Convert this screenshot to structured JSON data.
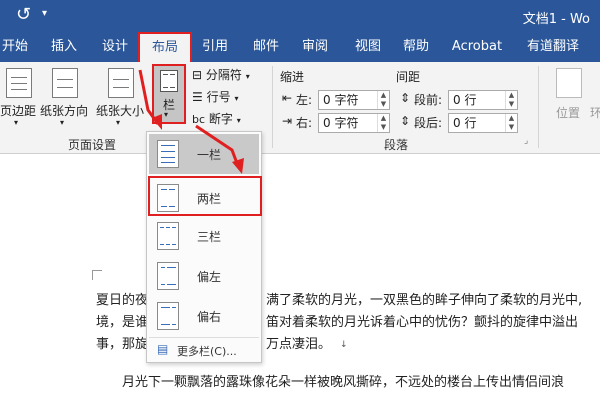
{
  "titlebar": {
    "doc_title": "文档1 - Wo"
  },
  "tabs": [
    {
      "label": "开始"
    },
    {
      "label": "插入"
    },
    {
      "label": "设计"
    },
    {
      "label": "布局"
    },
    {
      "label": "引用"
    },
    {
      "label": "邮件"
    },
    {
      "label": "审阅"
    },
    {
      "label": "视图"
    },
    {
      "label": "帮助"
    },
    {
      "label": "Acrobat"
    },
    {
      "label": "有道翻译"
    }
  ],
  "ribbon": {
    "margins": "页边距",
    "orientation": "纸张方向",
    "size": "纸张大小",
    "columns": "栏",
    "breaks": "分隔符",
    "line_numbers": "行号",
    "hyphenation": "断字",
    "page_setup_label": "页面设置",
    "indent_title": "缩进",
    "spacing_title": "间距",
    "indent_left_label": "左:",
    "indent_left_value": "0 字符",
    "indent_right_label": "右:",
    "indent_right_value": "0 字符",
    "spacing_before_label": "段前:",
    "spacing_before_value": "0 行",
    "spacing_after_label": "段后:",
    "spacing_after_value": "0 行",
    "paragraph_label": "段落",
    "position": "位置"
  },
  "columns_menu": {
    "items": [
      {
        "label": "一栏"
      },
      {
        "label": "两栏"
      },
      {
        "label": "三栏"
      },
      {
        "label": "偏左"
      },
      {
        "label": "偏右"
      }
    ],
    "more": "更多栏(C)..."
  },
  "document": {
    "line1a": "夏日的夜",
    "line1b": "满了柔软的月光，一双黑色的眸子伸向了柔软的月光中,",
    "line2a": "境，是谁",
    "line2b": "笛对着柔软的月光诉着心中的忧伤？颤抖的旋律中溢出",
    "line3a": "事，那旋",
    "line3b": "万点凄泪。",
    "line4": "月光下一颗飘落的露珠像花朵一样被晚风撕碎，不远处的楼台上传出情侣间浪"
  },
  "colors": {
    "accent": "#2b579a",
    "highlight": "#e02020"
  }
}
